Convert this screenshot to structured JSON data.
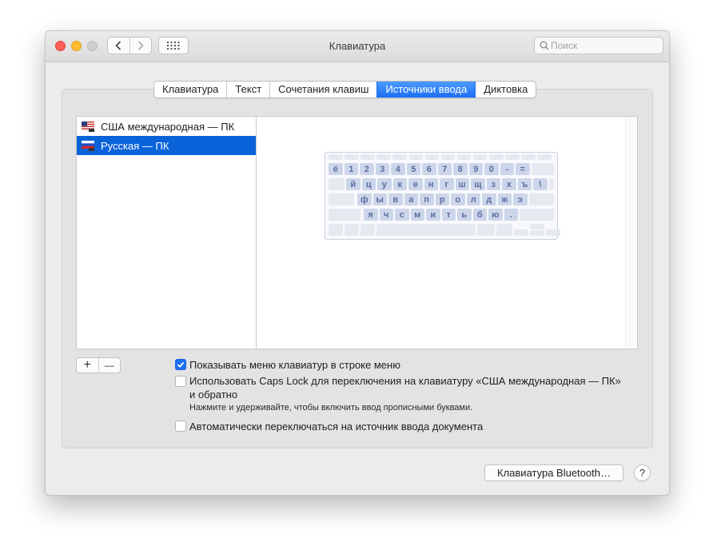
{
  "window": {
    "title": "Клавиатура",
    "search_placeholder": "Поиск"
  },
  "tabs": [
    {
      "label": "Клавиатура",
      "active": false
    },
    {
      "label": "Текст",
      "active": false
    },
    {
      "label": "Сочетания клавиш",
      "active": false
    },
    {
      "label": "Источники ввода",
      "active": true
    },
    {
      "label": "Диктовка",
      "active": false
    }
  ],
  "sources": [
    {
      "label": "США международная — ПК",
      "flag": "us-flag-icon",
      "selected": false
    },
    {
      "label": "Русская — ПК",
      "flag": "ru-flag-icon",
      "selected": true
    }
  ],
  "keyboard": {
    "rows": [
      [
        "ё",
        "1",
        "2",
        "3",
        "4",
        "5",
        "6",
        "7",
        "8",
        "9",
        "0",
        "-",
        "="
      ],
      [
        "й",
        "ц",
        "у",
        "к",
        "е",
        "н",
        "г",
        "ш",
        "щ",
        "з",
        "х",
        "ъ",
        "\\"
      ],
      [
        "ф",
        "ы",
        "в",
        "а",
        "п",
        "р",
        "о",
        "л",
        "д",
        "ж",
        "э"
      ],
      [
        "я",
        "ч",
        "с",
        "м",
        "и",
        "т",
        "ь",
        "б",
        "ю",
        "."
      ]
    ]
  },
  "list_buttons": {
    "add": "+",
    "remove": "—"
  },
  "options": {
    "show_menu": {
      "label": "Показывать меню клавиатур в строке меню",
      "checked": true
    },
    "caps_lock": {
      "label_line1": "Использовать Caps Lock для переключения на клавиатуру «США международная — ПК»",
      "label_line2": "и обратно",
      "checked": false,
      "hint": "Нажмите и удерживайте, чтобы включить ввод прописными буквами."
    },
    "auto_switch": {
      "label": "Автоматически переключаться на источник ввода документа",
      "checked": false
    }
  },
  "footer": {
    "bluetooth_button": "Клавиатура Bluetooth…",
    "help_button": "?"
  },
  "colors": {
    "accent": "#1b6ff5",
    "selection": "#0a63d9",
    "key_text": "#5a6ea0"
  }
}
